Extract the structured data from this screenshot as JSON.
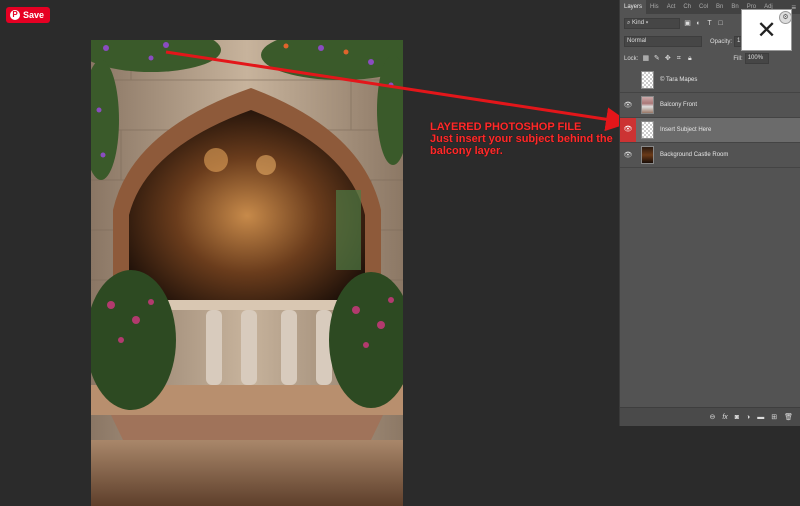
{
  "save_button": {
    "label": "Save",
    "icon": "pinterest-icon"
  },
  "annotation": {
    "line1": "LAYERED PHOTOSHOP FILE",
    "line2": "Just insert your subject behind the",
    "line3": "balcony layer.",
    "color": "#ff2a2a"
  },
  "panel": {
    "tabs": [
      "Layers",
      "His",
      "Act",
      "Ch",
      "Col",
      "Bn",
      "Bn",
      "Pro",
      "Adj"
    ],
    "filter_label": "Kind",
    "blend_mode": "Normal",
    "opacity_label": "Opacity:",
    "opacity_value": "1",
    "lock_label": "Lock:",
    "fill_label": "Fill:",
    "fill_value": "100%",
    "layers": [
      {
        "name": "© Tara Mapes",
        "visible": false,
        "selected": false,
        "thumb": "transparent"
      },
      {
        "name": "Balcony Front",
        "visible": true,
        "selected": false,
        "thumb": "balcony"
      },
      {
        "name": "Insert Subject Here",
        "visible": true,
        "selected": true,
        "thumb": "transparent"
      },
      {
        "name": "Background Castle Room",
        "visible": true,
        "selected": false,
        "thumb": "castle"
      }
    ],
    "footer_icons": [
      "link-icon",
      "fx-icon",
      "mask-icon",
      "adjustment-icon",
      "folder-icon",
      "new-layer-icon",
      "trash-icon"
    ]
  },
  "overlay": {
    "close_symbol": "✕",
    "corner_symbol": "⚙"
  }
}
